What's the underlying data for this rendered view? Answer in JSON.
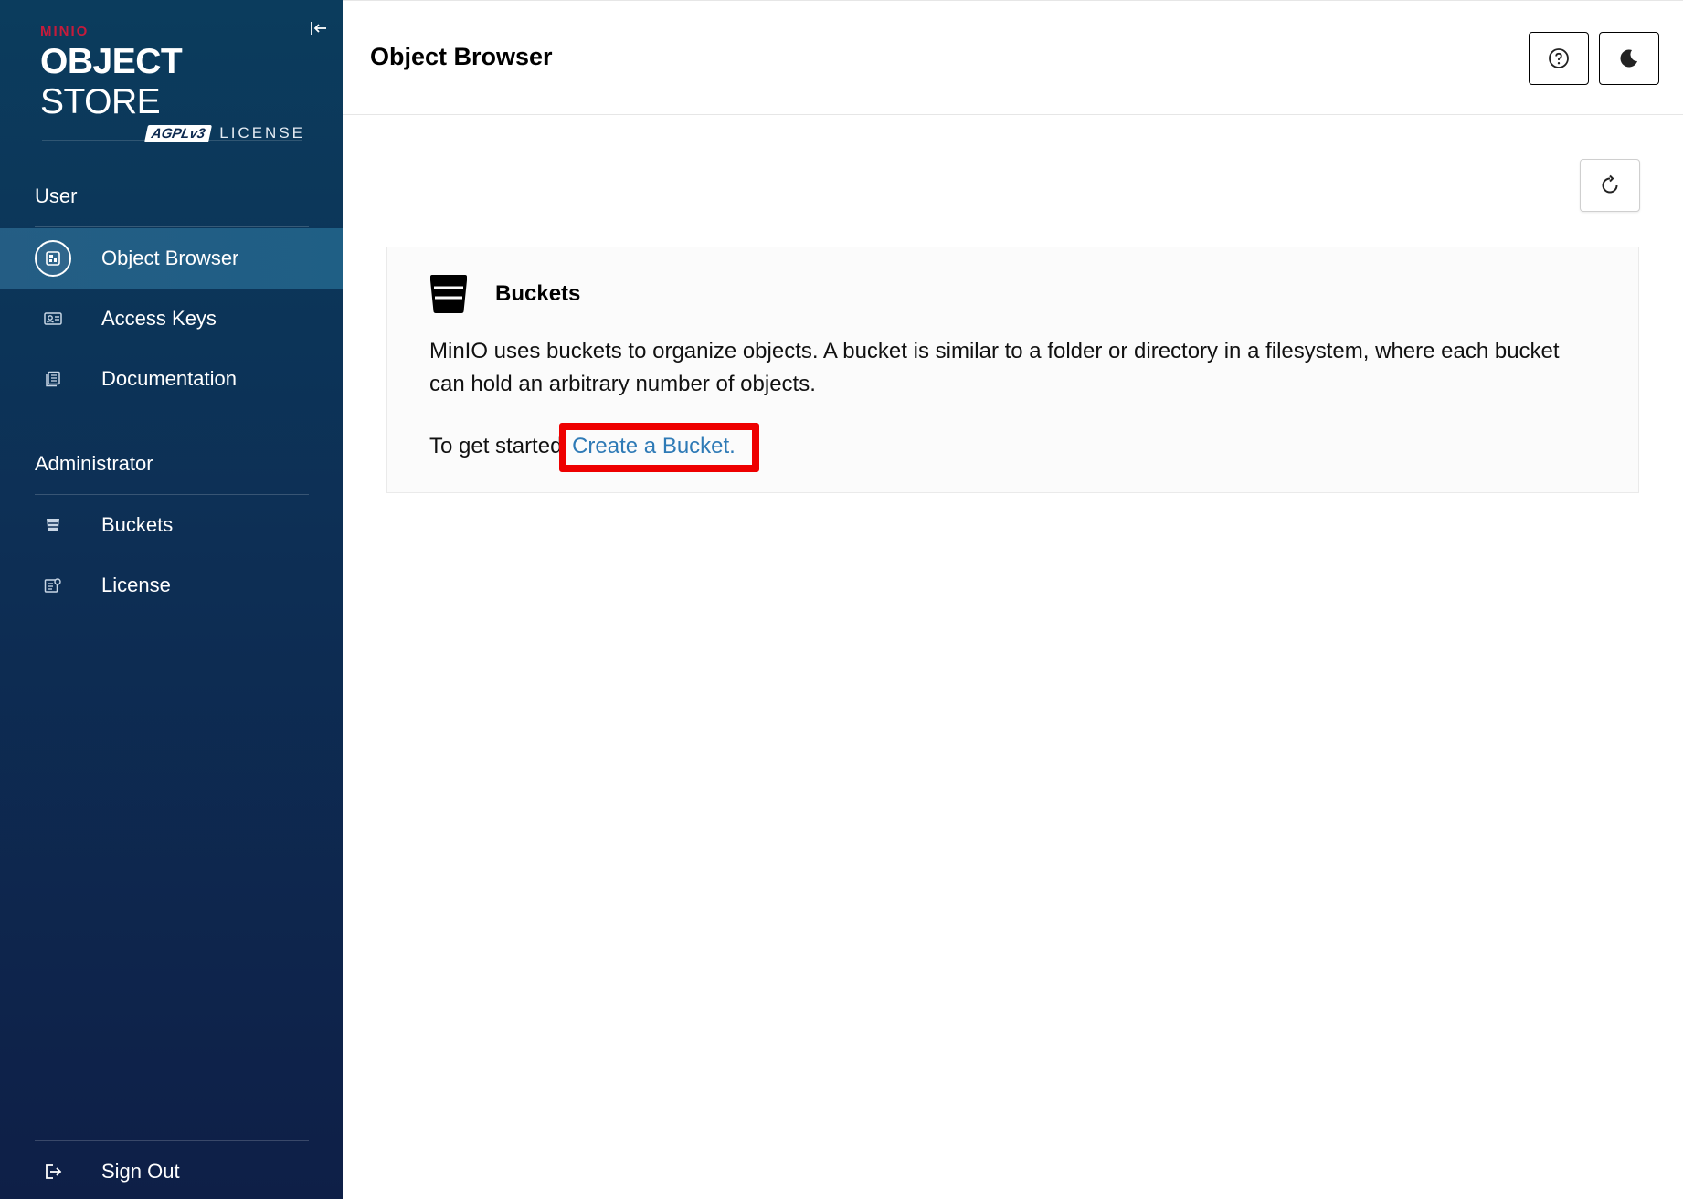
{
  "app": {
    "brand": "MINIO",
    "product_bold": "OBJECT",
    "product_light": "STORE",
    "license_badge": "AGPLv3",
    "license_word": "LICENSE"
  },
  "sidebar": {
    "sections": [
      {
        "title": "User",
        "items": [
          {
            "label": "Object Browser",
            "icon": "object-browser-icon",
            "active": true
          },
          {
            "label": "Access Keys",
            "icon": "access-keys-icon",
            "active": false
          },
          {
            "label": "Documentation",
            "icon": "documentation-icon",
            "active": false
          }
        ]
      },
      {
        "title": "Administrator",
        "items": [
          {
            "label": "Buckets",
            "icon": "bucket-icon",
            "active": false
          },
          {
            "label": "License",
            "icon": "license-icon",
            "active": false
          }
        ]
      }
    ],
    "sign_out": "Sign Out"
  },
  "header": {
    "title": "Object Browser",
    "help_icon": "help-icon",
    "theme_icon": "moon-icon"
  },
  "panel": {
    "title": "Buckets",
    "description": "MinIO uses buckets to organize objects. A bucket is similar to a folder or directory in a filesystem, where each bucket can hold an arbitrary number of objects.",
    "cta_prefix": "To get started,",
    "cta_link": "Create a Bucket."
  },
  "colors": {
    "sidebar_top": "#0b3c5d",
    "sidebar_bottom": "#0e1f47",
    "brand_red": "#c51b3b",
    "link_blue": "#2e7ab6",
    "highlight_red": "#ee0000"
  }
}
